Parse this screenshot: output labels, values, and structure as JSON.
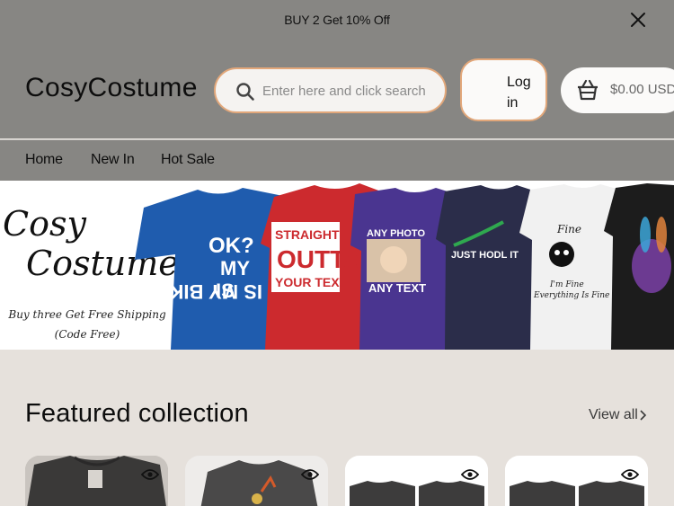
{
  "announcement": {
    "text": "BUY 2 Get 10% Off"
  },
  "header": {
    "logo": "CosyCostume",
    "search_placeholder": "Enter here and click search",
    "login_label": "Log in",
    "cart_total": "$0.00 USD"
  },
  "nav": {
    "items": [
      "Home",
      "New In",
      "Hot Sale"
    ]
  },
  "hero": {
    "title_line1": "Cosy",
    "title_line2": "Costume",
    "sub_line1": "Buy three Get Free Shipping",
    "sub_line2": "(Code Free)",
    "shirts": [
      {
        "color": "#1f5cae",
        "text": "IS MY BIKE OK?"
      },
      {
        "color": "#cc2a2e",
        "text": "STRAIGHT OUTTA YOUR TEXT"
      },
      {
        "color": "#4a3590",
        "text": "ANY PHOTO ANY TEXT"
      },
      {
        "color": "#2b2d4a",
        "text": "JUST HODL IT"
      },
      {
        "color": "#f1f1f1",
        "text": "I'm Fine Everything Is Fine"
      },
      {
        "color": "#1c1c1c",
        "text": ""
      }
    ]
  },
  "featured": {
    "title": "Featured collection",
    "view_all": "View all"
  },
  "colors": {
    "header_bg": "#878683",
    "accent_border": "#e2a77a",
    "page_bg": "#e6e1dc"
  },
  "icons": [
    "close-icon",
    "search-icon",
    "cart-icon",
    "chevron-right-icon",
    "eye-icon"
  ]
}
